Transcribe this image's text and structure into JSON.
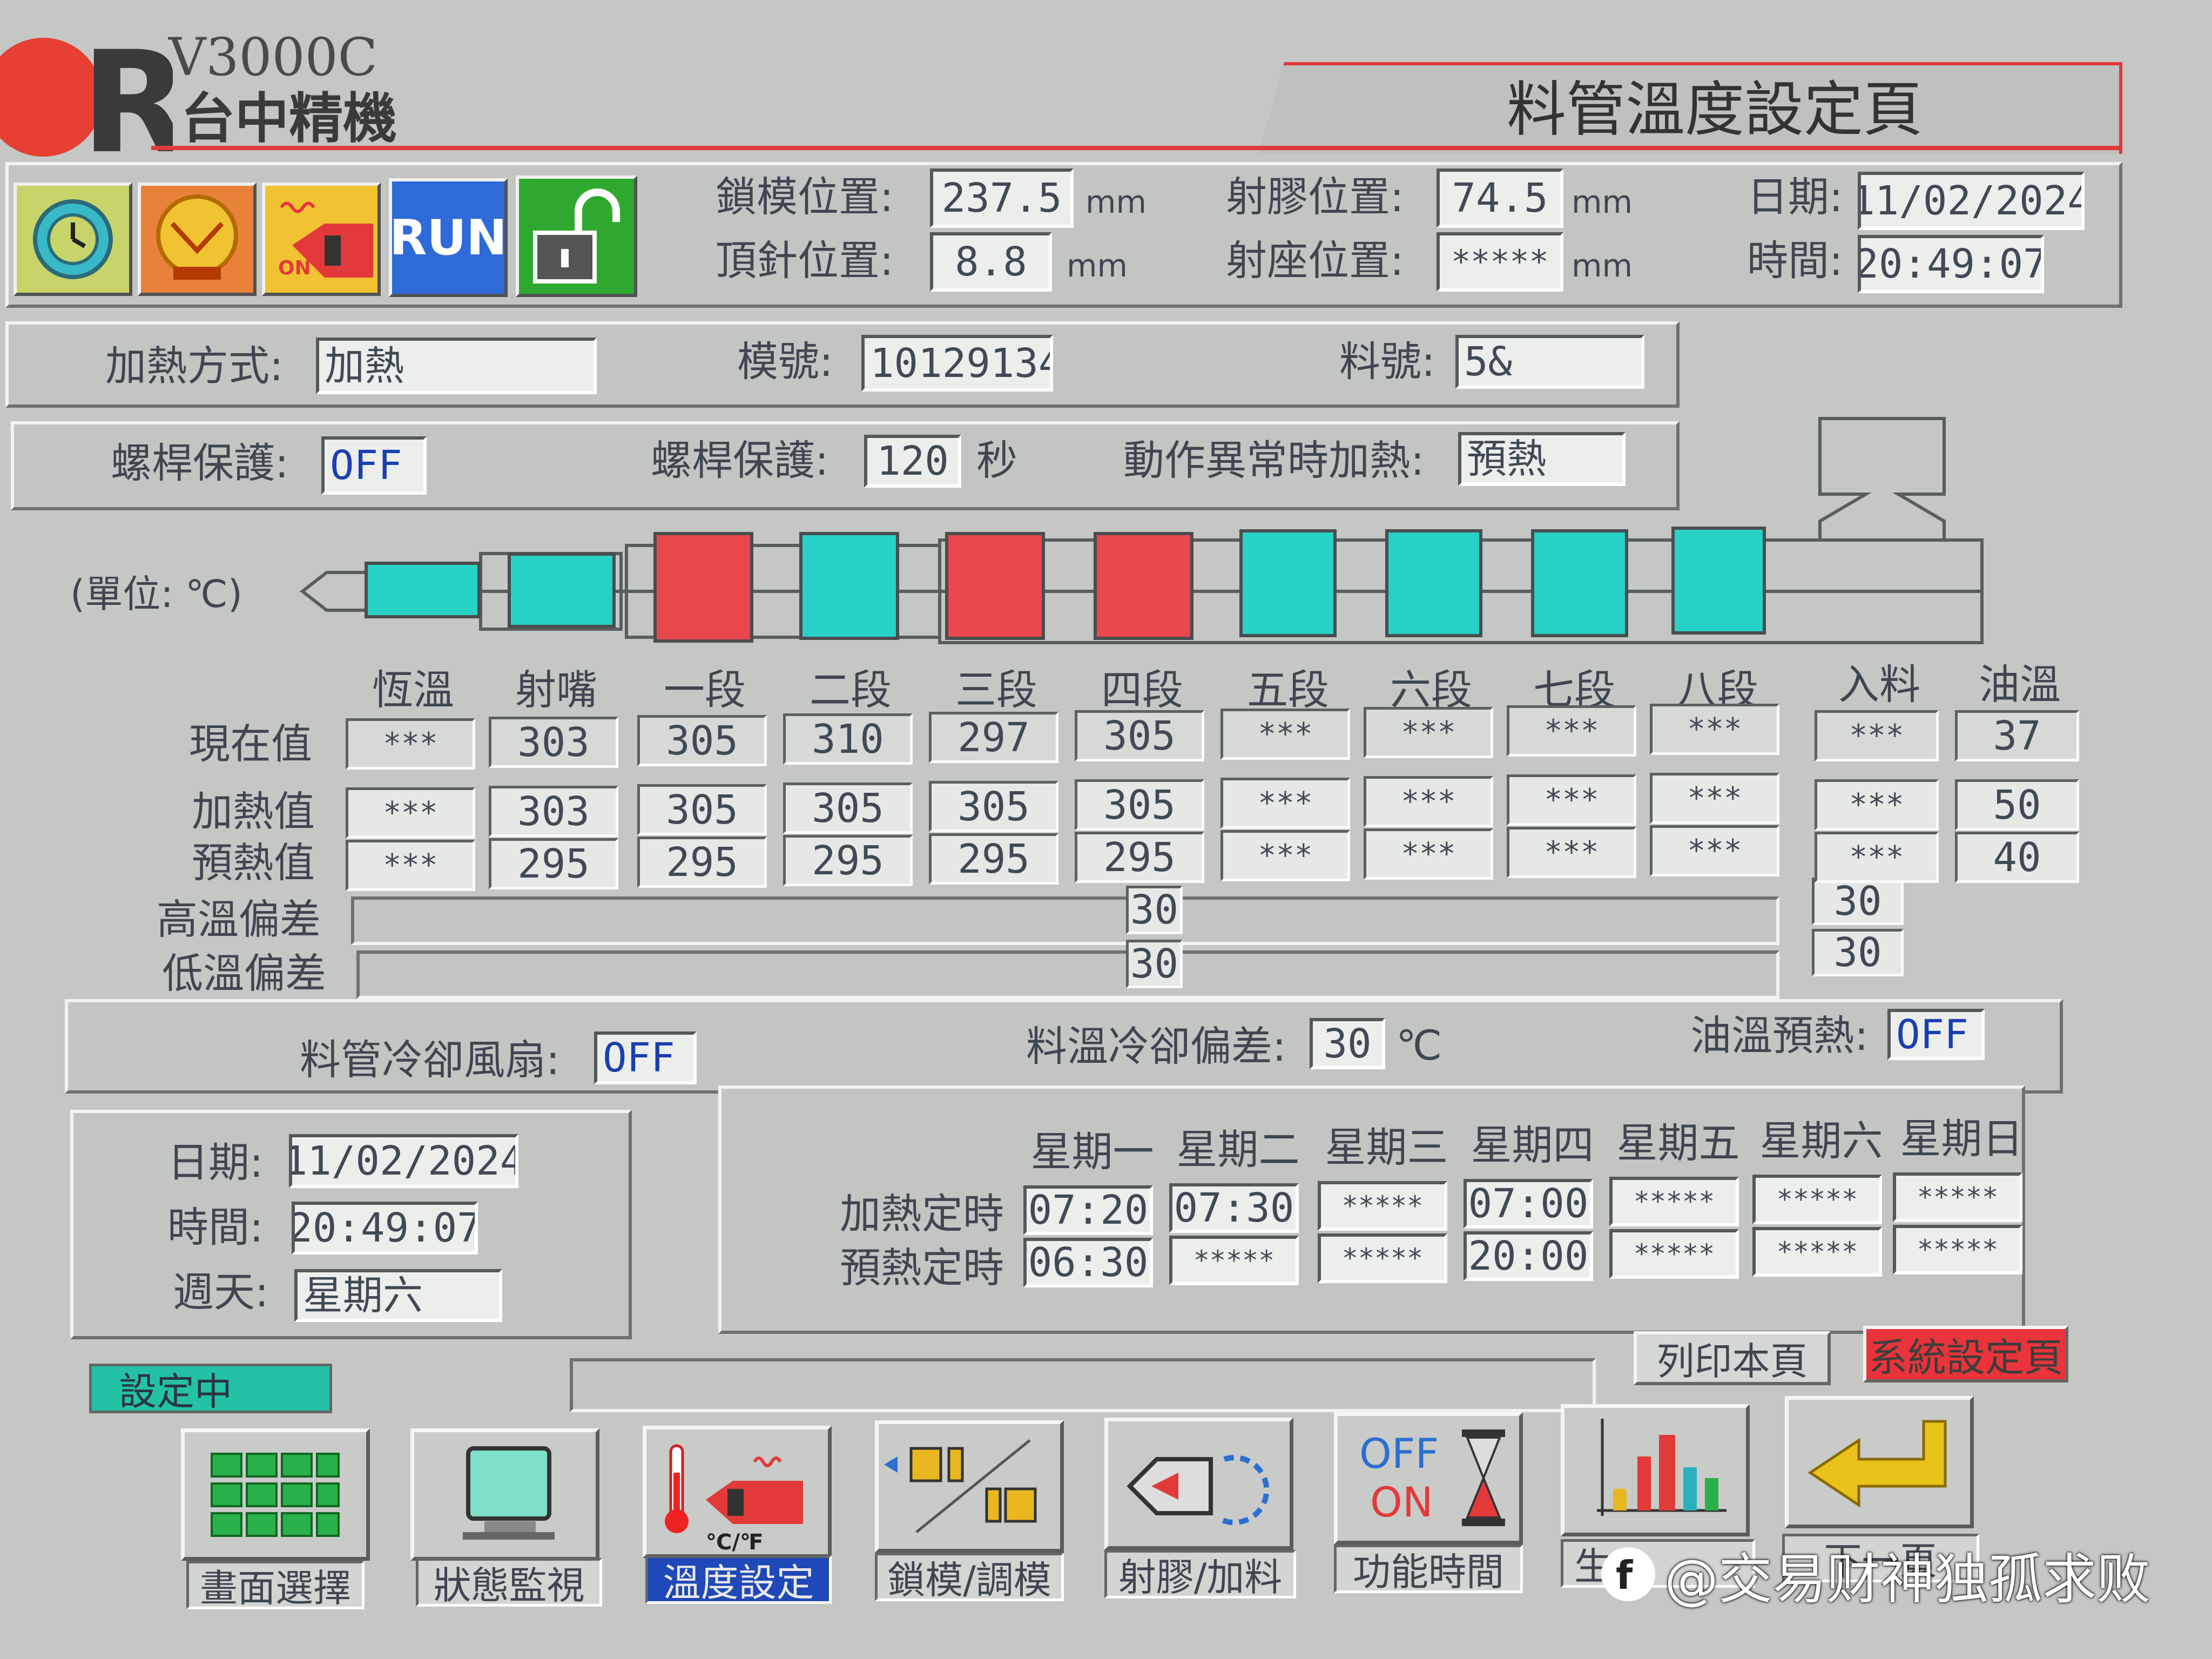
{
  "brand": {
    "model": "V3000C",
    "company": "台中精機"
  },
  "page_title": "料管溫度設定頁",
  "toolbar": {
    "run_label": "RUN",
    "heater_badge": "ON"
  },
  "header": {
    "clamp_pos_label": "鎖模位置:",
    "clamp_pos": "237.5",
    "clamp_pos_unit": "mm",
    "ejector_pos_label": "頂針位置:",
    "ejector_pos": "8.8",
    "ejector_pos_unit": "mm",
    "inject_pos_label": "射膠位置:",
    "inject_pos": "74.5",
    "inject_pos_unit": "mm",
    "carriage_pos_label": "射座位置:",
    "carriage_pos": "*****",
    "carriage_pos_unit": "mm",
    "date_label": "日期:",
    "date": "11/02/2024",
    "time_label": "時間:",
    "time": "20:49:07"
  },
  "info": {
    "heat_mode_label": "加熱方式:",
    "heat_mode": "加熱",
    "mold_label": "模號:",
    "mold_no": "10129134",
    "material_label": "料號:",
    "material_no": "5&"
  },
  "protect": {
    "screw_protect_label": "螺桿保護:",
    "screw_protect": "OFF",
    "screw_time_label": "螺桿保護:",
    "screw_time": "120",
    "screw_time_unit": "秒",
    "abnormal_heat_label": "動作異常時加熱:",
    "abnormal_heat": "預熱"
  },
  "unit_label": "(單位: ℃)",
  "zones": {
    "headers": [
      "恆溫",
      "射嘴",
      "一段",
      "二段",
      "三段",
      "四段",
      "五段",
      "六段",
      "七段",
      "八段"
    ],
    "extra_headers": [
      "入料",
      "油溫"
    ],
    "row_labels": [
      "現在值",
      "加熱值",
      "預熱值",
      "高溫偏差",
      "低溫偏差"
    ],
    "current": [
      "***",
      "303",
      "305",
      "310",
      "297",
      "305",
      "***",
      "***",
      "***",
      "***"
    ],
    "heat": [
      "***",
      "303",
      "305",
      "305",
      "305",
      "305",
      "***",
      "***",
      "***",
      "***"
    ],
    "preheat": [
      "***",
      "295",
      "295",
      "295",
      "295",
      "295",
      "***",
      "***",
      "***",
      "***"
    ],
    "extra_current": [
      "***",
      "37"
    ],
    "extra_heat": [
      "***",
      "50"
    ],
    "extra_preheat": [
      "***",
      "40"
    ],
    "high_dev": "30",
    "low_dev": "30",
    "extra_high_dev": "30",
    "extra_low_dev": "30"
  },
  "barrel_colors": {
    "heating": "#e8474c",
    "normal": "#28d1c6"
  },
  "cooling": {
    "fan_label": "料管冷卻風扇:",
    "fan": "OFF",
    "dev_label": "料溫冷卻偏差:",
    "dev": "30",
    "dev_unit": "℃",
    "oil_preheat_label": "油溫預熱:",
    "oil_preheat": "OFF"
  },
  "clock": {
    "date_label": "日期:",
    "date": "11/02/2024",
    "time_label": "時間:",
    "time": "20:49:07",
    "weekday_label": "週天:",
    "weekday": "星期六"
  },
  "schedule": {
    "days": [
      "星期一",
      "星期二",
      "星期三",
      "星期四",
      "星期五",
      "星期六",
      "星期日"
    ],
    "heat_label": "加熱定時",
    "preheat_label": "預熱定時",
    "heat": [
      "07:20",
      "07:30",
      "*****",
      "07:00",
      "*****",
      "*****",
      "*****"
    ],
    "preheat": [
      "06:30",
      "*****",
      "*****",
      "20:00",
      "*****",
      "*****",
      "*****"
    ]
  },
  "status": {
    "setting_badge": "設定中",
    "print_button": "列印本頁",
    "system_button": "系統設定頁"
  },
  "nav": [
    "畫面選擇",
    "狀態監視",
    "溫度設定",
    "鎖模/調模",
    "射膠/加料",
    "功能時間",
    "生",
    "下一頁"
  ],
  "nav_icon_text": {
    "off": "OFF",
    "on": "ON",
    "unit": "℃/℉"
  },
  "watermark": "@交易财神独孤求败"
}
